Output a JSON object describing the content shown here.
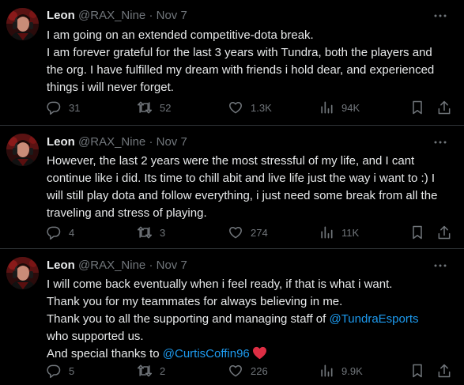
{
  "tweets": [
    {
      "name": "Leon",
      "handle": "@RAX_Nine",
      "dot": "·",
      "time": "Nov 7",
      "lines": [
        "I am going on an extended competitive-dota break.",
        "I am forever grateful for the last 3 years with Tundra, both the players and",
        "the org. I have fulfilled my dream with friends i hold dear, and experienced",
        "things i will never forget."
      ],
      "replies": "31",
      "retweets": "52",
      "likes": "1.3K",
      "views": "94K"
    },
    {
      "name": "Leon",
      "handle": "@RAX_Nine",
      "dot": "·",
      "time": "Nov 7",
      "lines": [
        "However, the last 2 years were the most stressful of my life, and I cant",
        "continue like i did. Its time to chill abit and live life just the way i want to :) I",
        "will still play dota and follow everything, i just need some break from all the",
        "traveling and stress of playing."
      ],
      "replies": "4",
      "retweets": "3",
      "likes": "274",
      "views": "11K"
    },
    {
      "name": "Leon",
      "handle": "@RAX_Nine",
      "dot": "·",
      "time": "Nov 7",
      "lines": [
        "I will come back eventually when i feel ready, if that is what i want.",
        "Thank you for my teammates for always believing in me.",
        "Thank you to all the supporting and managing staff of",
        "who supported us.",
        "And special thanks to"
      ],
      "mention_tundra": "@TundraEsports",
      "mention_curtis": "@CurtisCoffin96",
      "replies": "5",
      "retweets": "2",
      "likes": "226",
      "views": "9.9K"
    }
  ],
  "colors": {
    "background": "#000000",
    "text": "#e7e9ea",
    "muted": "#71767b",
    "link": "#1d9bf0",
    "heart": "#f91880",
    "divider": "#2f3336"
  },
  "icons": [
    "avatar",
    "more-icon",
    "reply-icon",
    "retweet-icon",
    "like-icon",
    "views-icon",
    "bookmark-icon",
    "share-icon",
    "red-heart-emoji"
  ]
}
